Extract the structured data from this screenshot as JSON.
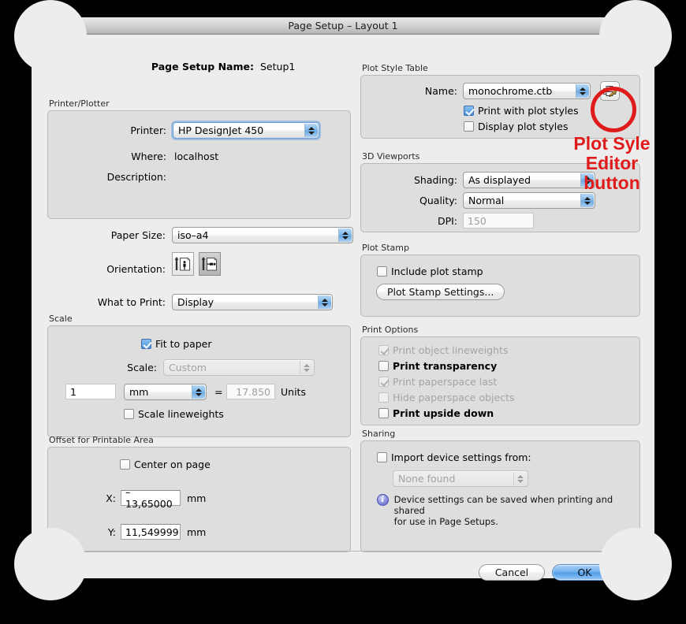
{
  "window": {
    "title": "Page Setup – Layout 1"
  },
  "setup_name": {
    "label": "Page Setup Name:",
    "value": "Setup1"
  },
  "printer_plotter": {
    "group_title": "Printer/Plotter",
    "printer_label": "Printer:",
    "printer_value": "HP DesignJet 450",
    "where_label": "Where:",
    "where_value": "localhost",
    "description_label": "Description:",
    "description_value": ""
  },
  "paper": {
    "paper_size_label": "Paper Size:",
    "paper_size_value": "iso–a4",
    "orientation_label": "Orientation:",
    "orientation_portrait": "portrait-orientation",
    "orientation_landscape": "landscape-orientation",
    "orientation_selected": "landscape",
    "what_to_print_label": "What to Print:",
    "what_to_print_value": "Display"
  },
  "scale": {
    "group_title": "Scale",
    "fit_to_paper_label": "Fit to paper",
    "fit_to_paper_checked": true,
    "scale_label": "Scale:",
    "scale_value": "Custom",
    "scale_disabled": true,
    "numerator_value": "1",
    "unit_value": "mm",
    "equals": "=",
    "denominator_value": "17.850",
    "units_label": "Units",
    "scale_lineweights_label": "Scale lineweights",
    "scale_lineweights_checked": false
  },
  "offset": {
    "group_title": "Offset for Printable Area",
    "center_on_page_label": "Center on page",
    "center_on_page_checked": false,
    "x_label": "X:",
    "x_value": "–13,65000",
    "x_unit": "mm",
    "y_label": "Y:",
    "y_value": "11,549999",
    "y_unit": "mm"
  },
  "plot_style_table": {
    "group_title": "Plot Style Table",
    "name_label": "Name:",
    "name_value": "monochrome.ctb",
    "editor_button": "plot-style-editor",
    "print_with_plot_styles_label": "Print with plot styles",
    "print_with_plot_styles_checked": true,
    "display_plot_styles_label": "Display plot styles",
    "display_plot_styles_checked": false
  },
  "viewports_3d": {
    "group_title": "3D Viewports",
    "shading_label": "Shading:",
    "shading_value": "As displayed",
    "quality_label": "Quality:",
    "quality_value": "Normal",
    "dpi_label": "DPI:",
    "dpi_value": "150",
    "dpi_disabled": true
  },
  "plot_stamp": {
    "group_title": "Plot Stamp",
    "include_label": "Include plot stamp",
    "include_checked": false,
    "settings_button": "Plot Stamp Settings..."
  },
  "print_options": {
    "group_title": "Print Options",
    "items": [
      {
        "label": "Print object lineweights",
        "checked": true,
        "disabled": true
      },
      {
        "label": "Print transparency",
        "checked": false,
        "disabled": false
      },
      {
        "label": "Print paperspace last",
        "checked": true,
        "disabled": true
      },
      {
        "label": "Hide paperspace objects",
        "checked": false,
        "disabled": true
      },
      {
        "label": "Print upside down",
        "checked": false,
        "disabled": false
      }
    ]
  },
  "sharing": {
    "group_title": "Sharing",
    "import_label": "Import device settings from:",
    "import_checked": false,
    "device_value": "None found",
    "device_disabled": true,
    "note_line1": "Device settings can be saved when printing and shared",
    "note_line2": "for use in Page Setups."
  },
  "footer": {
    "help_label": "?",
    "cancel_label": "Cancel",
    "ok_label": "OK"
  },
  "annotation": {
    "line1": "Plot Syle",
    "line2": "Editor",
    "line3": "button",
    "color": "#e01b1b"
  }
}
